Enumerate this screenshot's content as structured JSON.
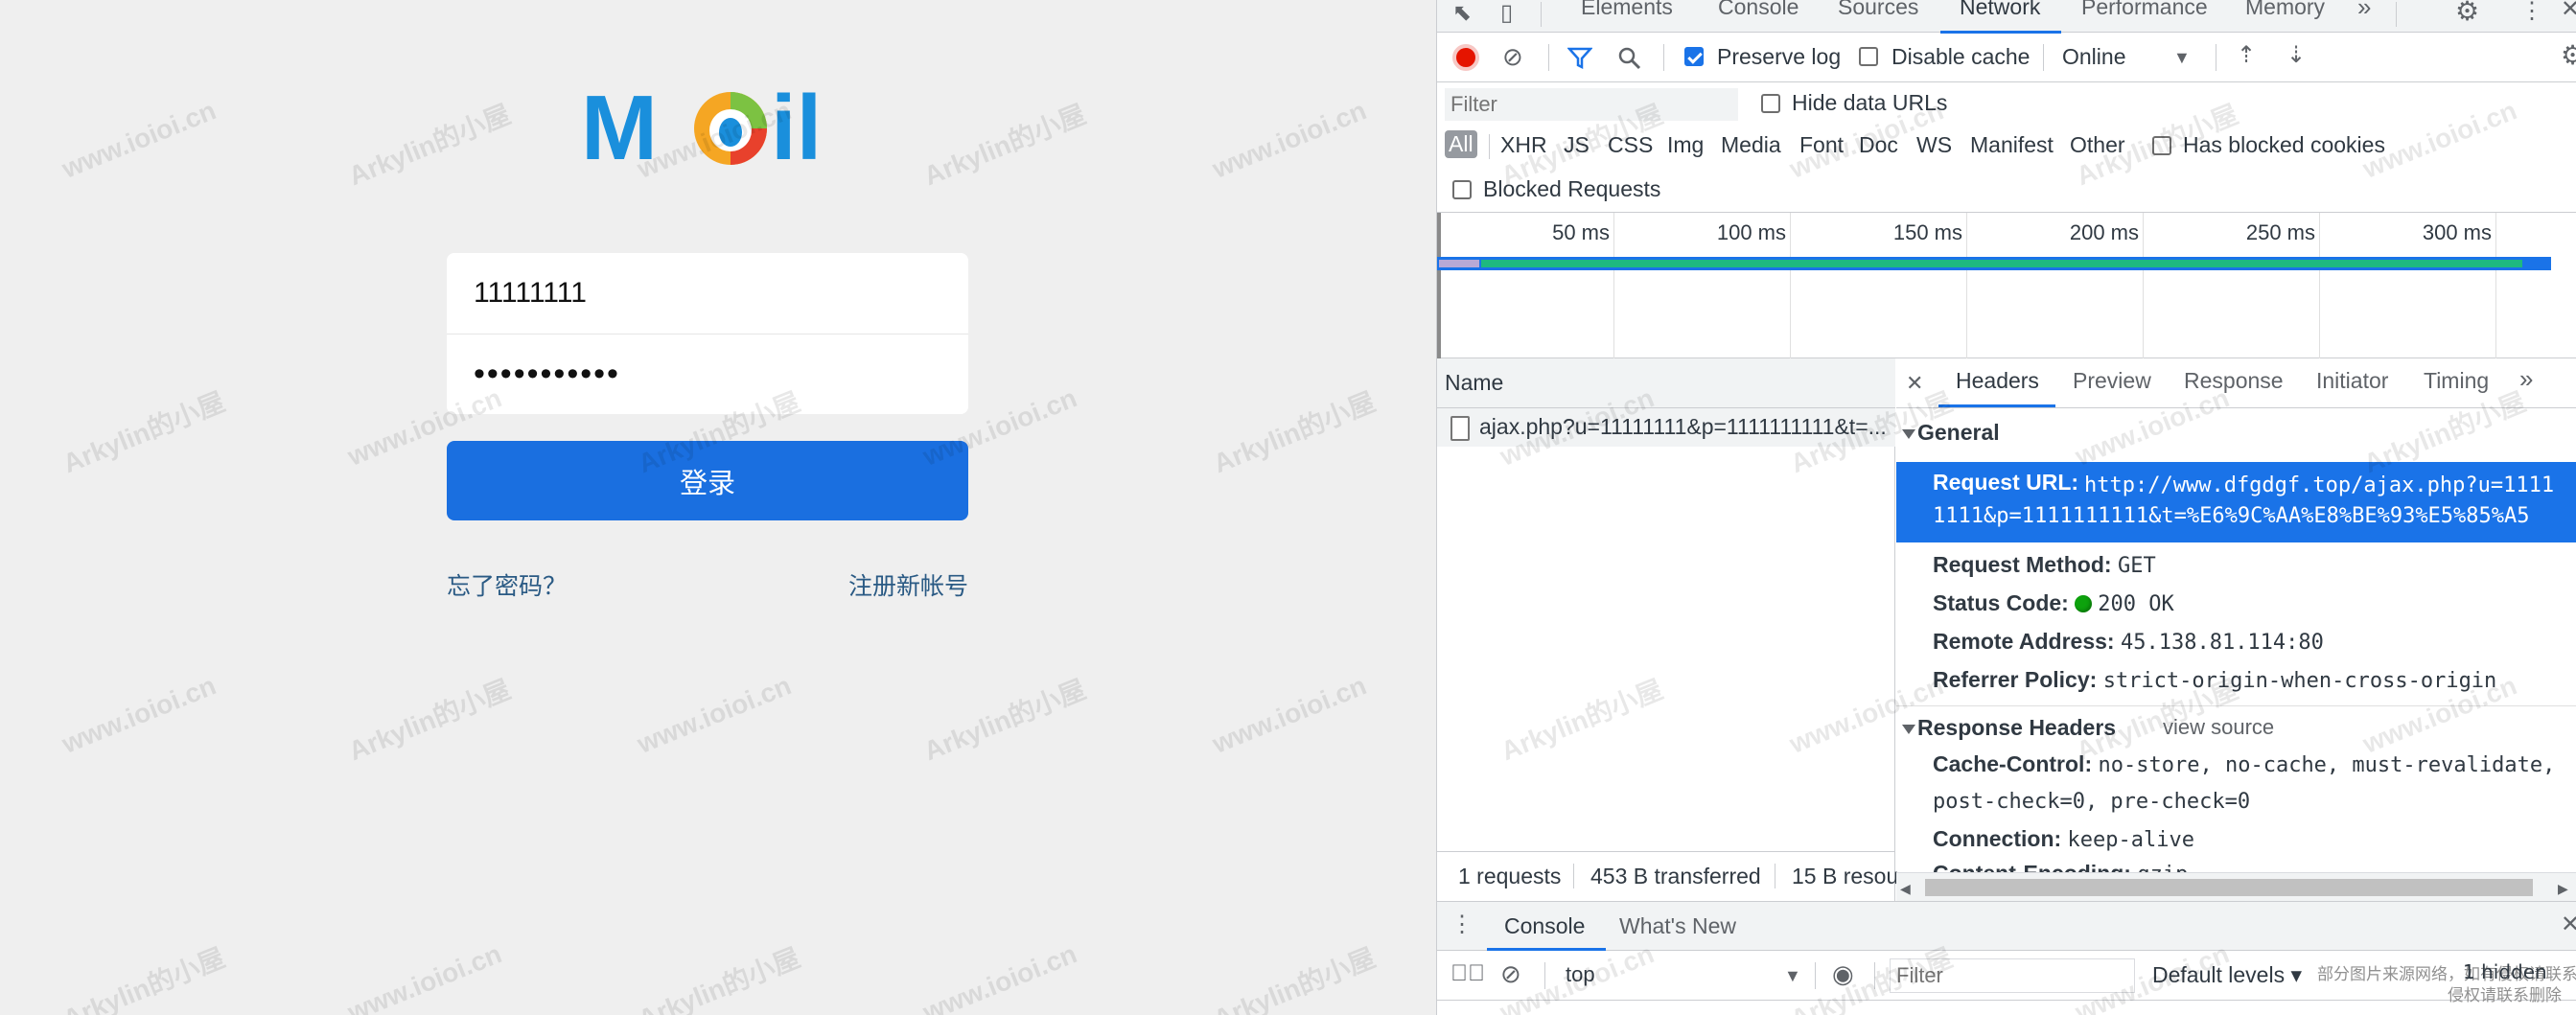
{
  "login": {
    "username_value": "11111111",
    "password_value": "•••••••••••",
    "login_button": "登录",
    "forgot_link": "忘了密码？",
    "register_link": "注册新帐号",
    "logo_letters": {
      "m": "M",
      "o": "o",
      "il": "il"
    }
  },
  "watermarks": {
    "site": "www.ioioi.cn",
    "author": "Arkylin的小屋"
  },
  "devtools": {
    "tabs": [
      "Elements",
      "Console",
      "Sources",
      "Network",
      "Performance",
      "Memory"
    ],
    "more_tabs": "»",
    "toolbar": {
      "preserve_log": "Preserve log",
      "disable_cache": "Disable cache",
      "throttle": "Online"
    },
    "filter": {
      "placeholder": "Filter",
      "hide_data_urls": "Hide data URLs",
      "has_blocked_cookies": "Has blocked cookies",
      "blocked_requests": "Blocked Requests"
    },
    "types": [
      "All",
      "XHR",
      "JS",
      "CSS",
      "Img",
      "Media",
      "Font",
      "Doc",
      "WS",
      "Manifest",
      "Other"
    ],
    "timeline_ticks": [
      "50 ms",
      "100 ms",
      "150 ms",
      "200 ms",
      "250 ms",
      "300 ms"
    ],
    "name_header": "Name",
    "request_name": "ajax.php?u=11111111&p=1111111111&t=...",
    "status_bar": {
      "requests": "1 requests",
      "transferred": "453 B transferred",
      "resources": "15 B resou"
    },
    "detail_tabs": [
      "Headers",
      "Preview",
      "Response",
      "Initiator",
      "Timing"
    ],
    "general": {
      "title": "General",
      "request_url_key": "Request URL:",
      "request_url_line1": "http://www.dfgdgf.top/ajax.php?u=1111",
      "request_url_line2": "1111&p=1111111111&t=%E6%9C%AA%E8%BE%93%E5%85%A5",
      "method_key": "Request Method:",
      "method_val": "GET",
      "status_key": "Status Code:",
      "status_val": "200 OK",
      "remote_key": "Remote Address:",
      "remote_val": "45.138.81.114:80",
      "referrer_key": "Referrer Policy:",
      "referrer_val": "strict-origin-when-cross-origin"
    },
    "response_headers": {
      "title": "Response Headers",
      "view_source": "view source",
      "cache_key": "Cache-Control:",
      "cache_val1": "no-store, no-cache, must-revalidate,",
      "cache_val2": "post-check=0, pre-check=0",
      "connection_key": "Connection:",
      "connection_val": "keep-alive",
      "encoding_key": "Content-Encoding:",
      "encoding_val": "gzip"
    },
    "drawer_tabs": [
      "Console",
      "What's New"
    ],
    "console_bar": {
      "context": "top",
      "filter_placeholder": "Filter",
      "levels": "Default levels ▾",
      "hidden": "1 hidden"
    },
    "notice_line1": "部分图片来源网络，如有侵权请联系删除",
    "notice_line2": "侵权请联系删除"
  },
  "colors": {
    "accent": "#1a73e8",
    "login_button": "#1a6fe0",
    "link": "#2a5a84",
    "record": "#e51400",
    "timing_bar": "#1eb980"
  }
}
